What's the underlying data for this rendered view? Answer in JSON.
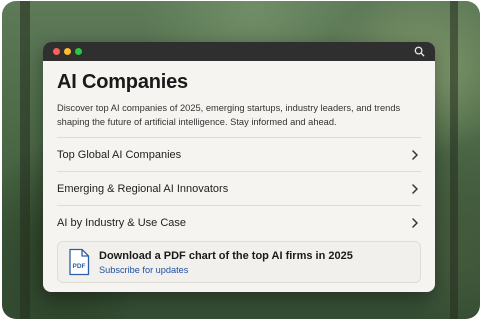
{
  "window": {
    "controls": [
      "close",
      "minimize",
      "maximize"
    ],
    "toolbar_icon": "search-icon"
  },
  "page": {
    "title": "AI Companies",
    "description": "Discover top AI companies of 2025, emerging startups, industry leaders, and trends shaping the future of artificial intelligence. Stay informed and ahead."
  },
  "list": {
    "items": [
      {
        "label": "Top Global AI Companies",
        "icon": "chevron-right-icon"
      },
      {
        "label": "Emerging & Regional AI Innovators",
        "icon": "chevron-right-icon"
      },
      {
        "label": "AI by Industry & Use Case",
        "icon": "chevron-right-icon"
      }
    ]
  },
  "pdf_card": {
    "icon_text": "PDF",
    "title": "Download a PDF chart of the top AI firms in 2025",
    "link": "Subscribe for updates"
  },
  "colors": {
    "accent_link": "#1f4fa0",
    "pdf_icon": "#2d5fa8",
    "titlebar": "#2f2f2f"
  }
}
